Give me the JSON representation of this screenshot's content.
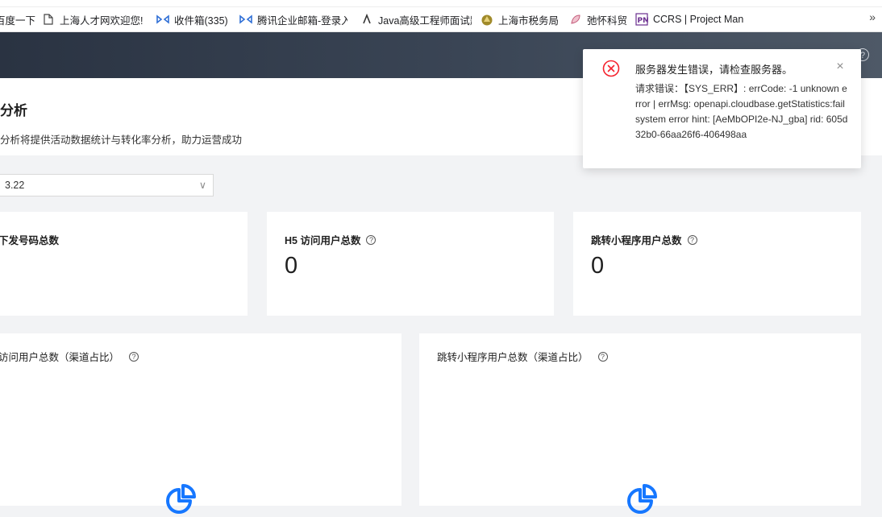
{
  "bookmarks": [
    {
      "label": "百度一下",
      "icon": "baidu-icon"
    },
    {
      "label": "上海人才网欢迎您!",
      "icon": "page-icon"
    },
    {
      "label": "收件箱(335)",
      "icon": "tencent-mail-icon"
    },
    {
      "label": "腾讯企业邮箱-登录入",
      "icon": "tencent-mail-icon"
    },
    {
      "label": "Java高级工程师面试题",
      "icon": "java-icon"
    },
    {
      "label": "上海市税务局",
      "icon": "tax-emblem-icon"
    },
    {
      "label": "弛怀科贸",
      "icon": "leaf-icon"
    },
    {
      "label": "CCRS | Project Man",
      "icon": "pm-icon"
    }
  ],
  "bookmarks_more": "»",
  "header": {
    "help_icon": "?"
  },
  "page": {
    "title": "分析",
    "description": "分析将提供活动数据统计与转化率分析，助力运营成功"
  },
  "date_filter": {
    "value": "3.22",
    "caret": "∨"
  },
  "stats": [
    {
      "label": "下发号码总数",
      "value": "",
      "has_help": false
    },
    {
      "label": "H5 访问用户总数",
      "value": "0",
      "has_help": true
    },
    {
      "label": "跳转小程序用户总数",
      "value": "0",
      "has_help": true
    }
  ],
  "charts": [
    {
      "title": "访问用户总数（渠道占比）"
    },
    {
      "title": "跳转小程序用户总数（渠道占比）"
    }
  ],
  "help_glyph": "?",
  "notification": {
    "title": "服务器发生错误，请检查服务器。",
    "body": "请求错误：【SYS_ERR】: errCode: -1 unknown error | errMsg: openapi.cloudbase.getStatistics:fail system error hint: [AeMbOPI2e-NJ_gba] rid: 605d32b0-66aa26f6-406498aa",
    "close_glyph": "×"
  },
  "colors": {
    "error": "#f5222d",
    "chart_icon": "#1677ff",
    "header_dark": "#2a3342"
  }
}
